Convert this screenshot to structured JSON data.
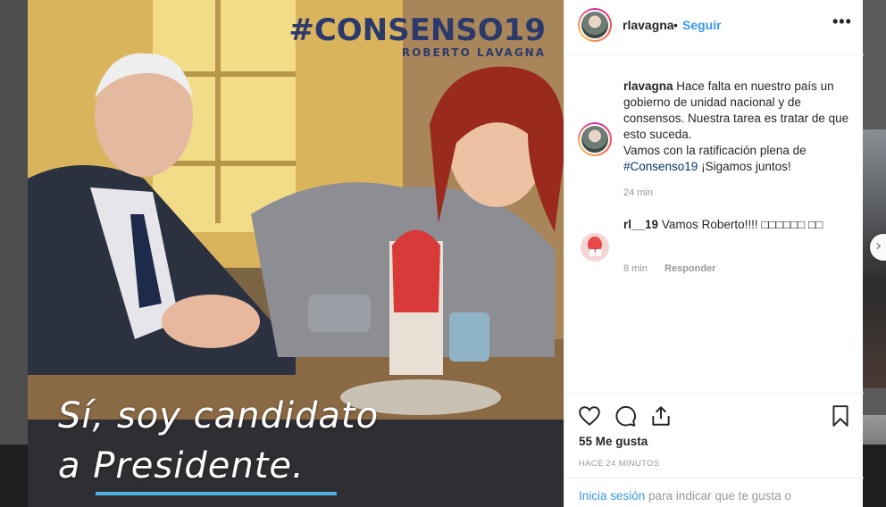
{
  "post": {
    "brand_hashtag": "#CONSENSO19",
    "brand_name": "ROBERTO LAVAGNA",
    "overlay_line1": "Sí, soy candidato",
    "overlay_line2": "a Presidente."
  },
  "header": {
    "username": "rlavagna",
    "separator": "•",
    "follow_label": "Seguir",
    "more_label": "•••"
  },
  "caption": {
    "username": "rlavagna",
    "text": "Hace falta en nuestro país un gobierno de unidad nacional y de consensos. Nuestra tarea es tratar de que esto suceda.",
    "text2": "Vamos con la ratificación plena de",
    "hashtag": "#Consenso19",
    "text3": "¡Sigamos juntos!",
    "time": "24 min"
  },
  "comment": {
    "username": "rl__19",
    "text": "Vamos Roberto!!!! □□□□□□ □□",
    "time": "8 min",
    "reply_label": "Responder"
  },
  "actions": {
    "icons": [
      "heart-icon",
      "comment-icon",
      "share-icon",
      "bookmark-icon"
    ],
    "likes": "55 Me gusta",
    "post_time": "HACE 24 MINUTOS"
  },
  "login": {
    "link": "Inicia sesión",
    "text": " para indicar que te gusta o"
  },
  "colors": {
    "link_blue": "#3897f0",
    "brand_navy": "#2b3a6b",
    "underline_blue": "#4fb0e6"
  }
}
